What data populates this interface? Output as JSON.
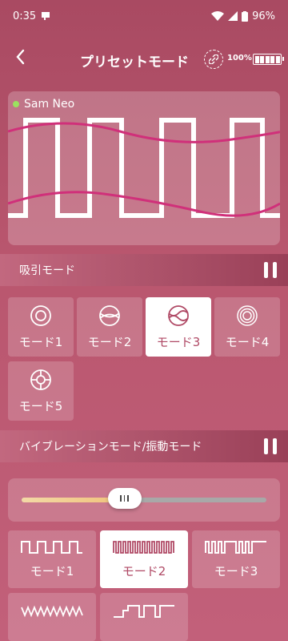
{
  "status": {
    "time": "0:35",
    "battery": "96%"
  },
  "header": {
    "title": "プリセットモード",
    "battery_text": "100%"
  },
  "device": {
    "name": "Sam Neo"
  },
  "suction": {
    "title": "吸引モード",
    "modes": [
      {
        "label": "モード1",
        "icon": "concentric-circle-icon"
      },
      {
        "label": "モード2",
        "icon": "ball-icon"
      },
      {
        "label": "モード3",
        "icon": "wave-circle-icon",
        "active": true
      },
      {
        "label": "モード4",
        "icon": "ripple-circle-icon"
      },
      {
        "label": "モード5",
        "icon": "target-circle-icon"
      }
    ]
  },
  "vibration": {
    "title": "バイブレーションモード/振動モード",
    "level": 0.42,
    "modes": [
      {
        "label": "モード1",
        "icon": "square-wave-icon"
      },
      {
        "label": "モード2",
        "icon": "dense-square-wave-icon",
        "active": true
      },
      {
        "label": "モード3",
        "icon": "burst-square-wave-icon"
      },
      {
        "label": "",
        "icon": "zigzag-wave-icon"
      },
      {
        "label": "",
        "icon": "step-wave-icon"
      }
    ]
  },
  "colors": {
    "accent": "#b04a66",
    "wave": "#d0307a",
    "status_dot": "#9be25f"
  }
}
